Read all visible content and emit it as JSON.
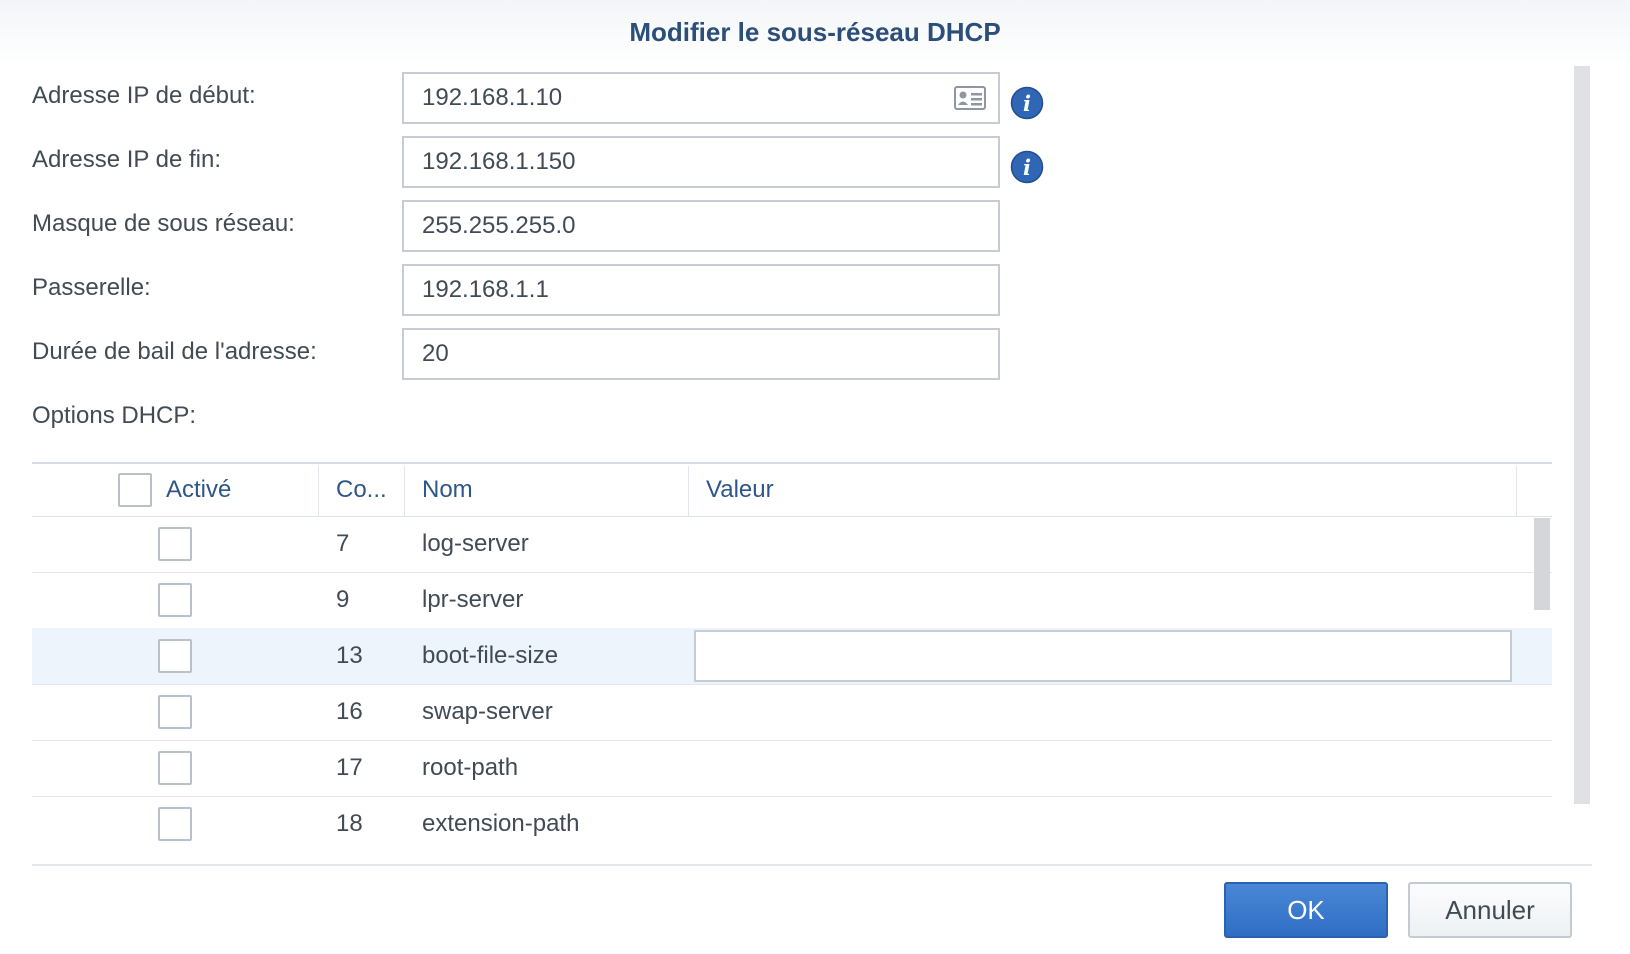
{
  "dialog": {
    "title": "Modifier le sous-réseau DHCP"
  },
  "form": {
    "start_ip": {
      "label": "Adresse IP de début:",
      "value": "192.168.1.10"
    },
    "end_ip": {
      "label": "Adresse IP de fin:",
      "value": "192.168.1.150"
    },
    "subnet_mask": {
      "label": "Masque de sous réseau:",
      "value": "255.255.255.0"
    },
    "gateway": {
      "label": "Passerelle:",
      "value": "192.168.1.1"
    },
    "lease_time": {
      "label": "Durée de bail de l'adresse:",
      "value": "20"
    },
    "options_label": "Options DHCP:"
  },
  "grid": {
    "columns": {
      "active": "Activé",
      "code": "Co...",
      "name": "Nom",
      "value": "Valeur"
    },
    "rows": [
      {
        "code": "7",
        "name": "log-server",
        "value": "",
        "active": false
      },
      {
        "code": "9",
        "name": "lpr-server",
        "value": "",
        "active": false
      },
      {
        "code": "13",
        "name": "boot-file-size",
        "value": "",
        "active": false,
        "selected": true
      },
      {
        "code": "16",
        "name": "swap-server",
        "value": "",
        "active": false
      },
      {
        "code": "17",
        "name": "root-path",
        "value": "",
        "active": false
      },
      {
        "code": "18",
        "name": "extension-path",
        "value": "",
        "active": false
      }
    ]
  },
  "buttons": {
    "ok": "OK",
    "cancel": "Annuler"
  },
  "icons": {
    "contact_card": "contact-card-icon",
    "info": "info-icon"
  },
  "colors": {
    "title": "#2b4f7a",
    "accent": "#2f6ec4",
    "selected_row": "#eef4fc"
  }
}
